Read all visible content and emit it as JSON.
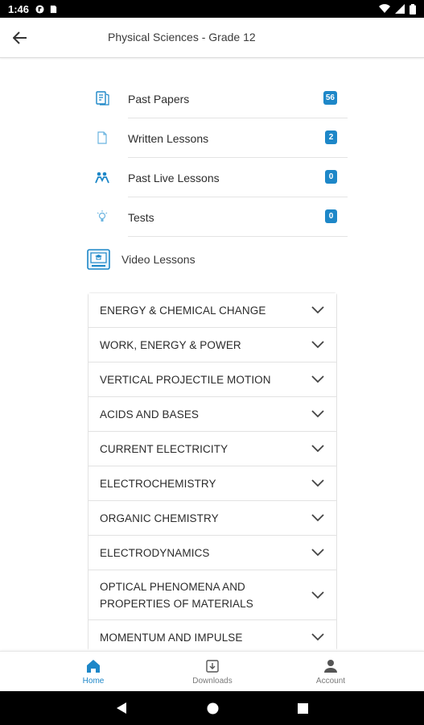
{
  "status_bar": {
    "time": "1:46"
  },
  "app_bar": {
    "title": "Physical Sciences - Grade 12"
  },
  "menu": [
    {
      "label": "Past Papers",
      "badge": "56",
      "icon": "past-papers-icon"
    },
    {
      "label": "Written Lessons",
      "badge": "2",
      "icon": "document-icon"
    },
    {
      "label": "Past Live Lessons",
      "badge": "0",
      "icon": "live-lessons-icon"
    },
    {
      "label": "Tests",
      "badge": "0",
      "icon": "lightbulb-icon"
    }
  ],
  "video_lessons": {
    "label": "Video Lessons",
    "icon": "video-lessons-icon"
  },
  "topics": [
    "ENERGY & CHEMICAL CHANGE",
    "WORK, ENERGY & POWER",
    "VERTICAL PROJECTILE MOTION",
    "ACIDS AND BASES",
    "CURRENT ELECTRICITY",
    "ELECTROCHEMISTRY",
    "ORGANIC CHEMISTRY",
    "ELECTRODYNAMICS",
    "OPTICAL PHENOMENA AND PROPERTIES OF MATERIALS",
    "MOMENTUM AND IMPULSE"
  ],
  "bottom_nav": {
    "home": "Home",
    "downloads": "Downloads",
    "account": "Account"
  },
  "colors": {
    "accent": "#1d87c8",
    "text": "#2e2e2e",
    "inactive": "#7a7a7a"
  }
}
